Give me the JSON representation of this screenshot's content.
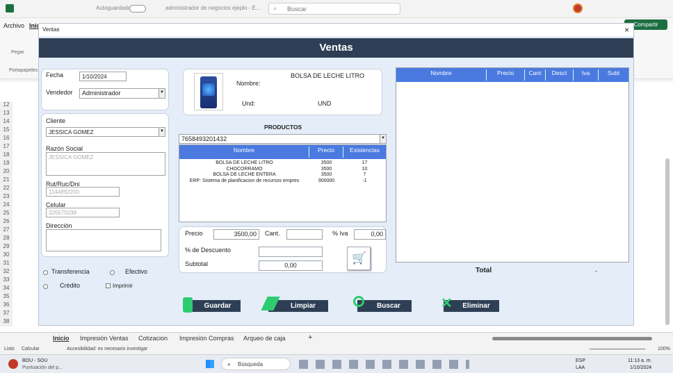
{
  "excel": {
    "autosave_label": "Autoguardado",
    "doc_title": "administrador de negocios ejeplo - E...",
    "search_placeholder": "Buscar",
    "ribbon_tabs": [
      "Archivo",
      "Inici"
    ],
    "share_button": "Compartir",
    "paste_label": "Pegar",
    "clipboard_label": "Portapapeles",
    "row_numbers": [
      "12",
      "13",
      "14",
      "15",
      "16",
      "17",
      "18",
      "19",
      "20",
      "21",
      "22",
      "23",
      "24",
      "25",
      "26",
      "27",
      "28",
      "29",
      "30",
      "31",
      "32",
      "33",
      "34",
      "35",
      "36",
      "37",
      "38"
    ],
    "sheet_tabs": [
      "Inicio",
      "Impresión Ventas",
      "Cotizacion",
      "Impresión Compras",
      "Arqueo de caja"
    ],
    "status_ready": "Listo",
    "status_calc": "Calcular",
    "status_accessibility": "Accesibilidad: es necesario investigar",
    "zoom": "100%"
  },
  "form": {
    "window_title": "Ventas",
    "banner_title": "Ventas",
    "fecha_label": "Fecha",
    "fecha_value": "1/10/2024",
    "vendedor_label": "Vendedor",
    "vendedor_value": "Administrador",
    "cliente_label": "Cliente",
    "cliente_value": "JESSICA GOMEZ",
    "razon_label": "Razón Social",
    "razon_value": "JESSICA GOMEZ",
    "rut_label": "Rut/Ruc/Dni",
    "rut_value": "1144892200",
    "celular_label": "Celular",
    "celular_value": "326575039",
    "direccion_label": "Dirección",
    "pay_transferencia": "Transferencia",
    "pay_efectivo": "Efectivo",
    "pay_credito": "Crédito",
    "imprimir_label": "Imprimir",
    "product_name_label": "Nombre:",
    "product_name_value": "BOLSA DE LECHE LITRO",
    "product_unit_label": "Und:",
    "product_unit_value": "UND",
    "productos_title": "PRODUCTOS",
    "product_code": "7658493201432",
    "product_columns": [
      "Nombre",
      "Precio",
      "Existencias"
    ],
    "product_rows": [
      {
        "nombre": "BOLSA DE LECHE LITRO",
        "precio": "3500",
        "exist": "17"
      },
      {
        "nombre": "CHOCORRAMO",
        "precio": "3500",
        "exist": "10"
      },
      {
        "nombre": "BOLSA DE LECHE ENTERA",
        "precio": "3500",
        "exist": "7"
      },
      {
        "nombre": "ERP: Sistema de planificacion de recursos empres",
        "precio": "900000",
        "exist": "-1"
      }
    ],
    "precio_label": "Precio",
    "precio_value": "3500,00",
    "cant_label": "Cant.",
    "cant_value": "",
    "iva_label": "% Iva",
    "iva_value": "0,00",
    "descuento_label": "% de Descuento",
    "descuento_value": "",
    "subtotal_label": "Subtotal",
    "subtotal_value": "0,00",
    "cart_columns": [
      "Nombre",
      "Precio",
      "Cant",
      "Desct",
      "Iva",
      "Subt"
    ],
    "total_label": "Total",
    "total_value": "-",
    "buttons": {
      "guardar": "Guardar",
      "limpiar": "Limpiar",
      "buscar": "Buscar",
      "eliminar": "Eliminar"
    },
    "colors": {
      "banner": "#2e3f55",
      "header": "#4a7ae0",
      "form_bg": "#e4edf8"
    }
  },
  "taskbar": {
    "app_name": "BOU - SOU",
    "app_sub": "Puntuación del p...",
    "search_label": "Búsqueda",
    "lang": "ESP",
    "lang2": "LAA",
    "time": "11:13 a. m.",
    "date": "1/10/2024"
  }
}
